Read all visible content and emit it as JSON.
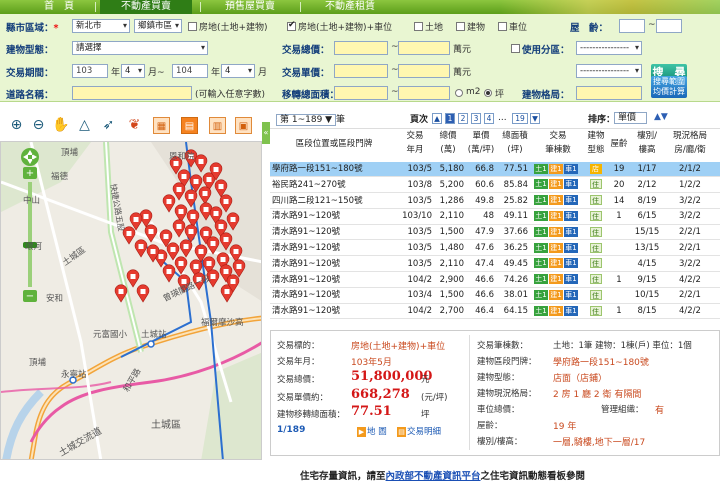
{
  "nav": {
    "tabs": [
      "首　頁",
      "不動產買賣",
      "預售屋買賣",
      "不動產租賃"
    ],
    "active": 1
  },
  "search": {
    "county_label": "縣市區域：",
    "county_value": "新北市",
    "district_value": "鄉鎮市區",
    "type_checks": [
      {
        "label": "房地(土地+建物)",
        "checked": false
      },
      {
        "label": "房地(土地+建物)+車位",
        "checked": true
      },
      {
        "label": "土地",
        "checked": false
      },
      {
        "label": "建物",
        "checked": false
      },
      {
        "label": "車位",
        "checked": false
      }
    ],
    "age_label": "屋　齡：",
    "age_sep": "~",
    "building_type_label": "建物型態：",
    "building_type_value": "請選擇",
    "total_price_label": "交易總價：",
    "unit_wan": "萬元",
    "range_sep": "~",
    "use_zone_label": "使用分區：",
    "use_zone_value1": "----------------",
    "use_zone_value2": "----------------",
    "search_button": "搜　尋",
    "period_label": "交易期間：",
    "year_from": "103",
    "month_from": "4",
    "year_to": "104",
    "month_to": "4",
    "year_word": "年",
    "month_word": "月~",
    "month_word_end": "月",
    "unit_price_label": "交易單價：",
    "road_label": "道路名稱：",
    "road_hint": "(可輸入任意字數)",
    "area_label": "移轉總面積：",
    "m2": "m2",
    "ping": "坪",
    "layout_label": "建物格局：",
    "calc_button": [
      "搜尋範圍",
      "均價計算"
    ]
  },
  "toolbar": {
    "icons": [
      "zoom-in-icon",
      "zoom-out-icon",
      "pan-icon",
      "measure-icon",
      "measure-area-icon",
      "marker-icon",
      "building-icon",
      "active-building-icon",
      "grid-icon",
      "layers-icon"
    ]
  },
  "map": {
    "labels": [
      "頂埔",
      "中山",
      "福德",
      "快捷公路五股",
      "土城區",
      "安和",
      "環河",
      "恩和院",
      "元富國小",
      "土城站",
      "永寧站",
      "和平路",
      "土城交流道",
      "土城區",
      "福爾摩沙高",
      "曾瑛閣路一段",
      "頂埔"
    ],
    "zoom_value": 0.55
  },
  "results": {
    "range_select": "第 1~189 ▼",
    "range_suffix": "筆",
    "page_label": "頁次",
    "pages": [
      "1",
      "2",
      "3",
      "4",
      "...",
      "19"
    ],
    "sort_label": "排序：",
    "sort_value": "單價",
    "sort_arrows": "▲▼",
    "headers": [
      "區段位置或區段門牌",
      "交易年月",
      "總價(萬)",
      "單價(萬/坪)",
      "總面積(坪)",
      "交易筆棟數",
      "建物型態",
      "屋齡",
      "樓別/樓高",
      "現況格局房廳衛"
    ],
    "rows": [
      {
        "addr": "學府路一段151~180號",
        "ym": "103/5",
        "total": "5,180",
        "unit": "66.8",
        "area": "77.51",
        "deal": [
          "土1",
          "建1",
          "車1"
        ],
        "type": "店",
        "age": "19",
        "floor": "1/17",
        "layout": "2/1/2",
        "selected": true
      },
      {
        "addr": "裕民路241~270號",
        "ym": "103/8",
        "total": "5,200",
        "unit": "60.6",
        "area": "85.84",
        "deal": [
          "土1",
          "建1",
          "車1"
        ],
        "type": "住",
        "age": "20",
        "floor": "2/12",
        "layout": "1/2/2",
        "selected": false
      },
      {
        "addr": "四川路二段121~150號",
        "ym": "103/5",
        "total": "1,286",
        "unit": "49.8",
        "area": "25.82",
        "deal": [
          "土1",
          "建1",
          "車1"
        ],
        "type": "住",
        "age": "14",
        "floor": "8/19",
        "layout": "3/2/2",
        "selected": false
      },
      {
        "addr": "清水路91~120號",
        "ym": "103/10",
        "total": "2,110",
        "unit": "48",
        "area": "49.11",
        "deal": [
          "土1",
          "建1",
          "車1"
        ],
        "type": "住",
        "age": "1",
        "floor": "6/15",
        "layout": "3/2/2",
        "selected": false
      },
      {
        "addr": "清水路91~120號",
        "ym": "103/5",
        "total": "1,500",
        "unit": "47.9",
        "area": "37.66",
        "deal": [
          "土1",
          "建1",
          "車1"
        ],
        "type": "住",
        "age": "",
        "floor": "15/15",
        "layout": "2/2/1",
        "selected": false
      },
      {
        "addr": "清水路91~120號",
        "ym": "103/5",
        "total": "1,480",
        "unit": "47.6",
        "area": "36.25",
        "deal": [
          "土1",
          "建1",
          "車1"
        ],
        "type": "住",
        "age": "",
        "floor": "13/15",
        "layout": "2/2/1",
        "selected": false
      },
      {
        "addr": "清水路91~120號",
        "ym": "103/5",
        "total": "2,110",
        "unit": "47.4",
        "area": "49.45",
        "deal": [
          "土1",
          "建1",
          "車1"
        ],
        "type": "住",
        "age": "",
        "floor": "4/15",
        "layout": "3/2/2",
        "selected": false
      },
      {
        "addr": "清水路91~120號",
        "ym": "104/2",
        "total": "2,900",
        "unit": "46.6",
        "area": "74.26",
        "deal": [
          "土1",
          "建1",
          "車1"
        ],
        "type": "住",
        "age": "1",
        "floor": "9/15",
        "layout": "4/2/2",
        "selected": false
      },
      {
        "addr": "清水路91~120號",
        "ym": "103/4",
        "total": "1,500",
        "unit": "46.6",
        "area": "38.01",
        "deal": [
          "土1",
          "建1",
          "車1"
        ],
        "type": "住",
        "age": "",
        "floor": "10/15",
        "layout": "2/2/1",
        "selected": false
      },
      {
        "addr": "清水路91~120號",
        "ym": "104/2",
        "total": "2,700",
        "unit": "46.4",
        "area": "64.15",
        "deal": [
          "土1",
          "建1",
          "車1"
        ],
        "type": "住",
        "age": "1",
        "floor": "8/15",
        "layout": "4/2/2",
        "selected": false
      }
    ]
  },
  "detail": {
    "category_label": "交易標的：",
    "category_value": "房地(土地+建物)+車位",
    "ym_label": "交易年月：",
    "ym_value": "103年5月",
    "total_label": "交易總價：",
    "total_value": "51,800,000",
    "total_unit": "元",
    "unit_label": "交易單價約：",
    "unit_value": "668,278",
    "unit_unit": "(元/坪)",
    "area_label": "建物移轉總面積：",
    "area_value": "77.51",
    "area_unit": "坪",
    "counter": "1/189",
    "map_link": "地 圖",
    "detail_link": "交易明細",
    "deal_count_label": "交易筆棟數：",
    "deal_count_value": "土地：1筆 建物：1棟(戶) 車位：1個",
    "addr_label": "建物區段門牌：",
    "addr_value": "學府路一段151~180號",
    "btype_label": "建物型態：",
    "btype_value": "店面（店鋪）",
    "layout_label": "建物現況格局：",
    "layout_value": "2 房 1 廳 2 衛 有隔間",
    "parking_label": "車位總價：",
    "mgmt_label": "管理組織：",
    "mgmt_value": "有",
    "age_label": "屋齡：",
    "age_value": "19 年",
    "floor_label": "樓別/樓高：",
    "floor_value": "一層,騎樓,地下一層/17"
  },
  "footer": {
    "prefix": "住宅存量資訊，請至",
    "link": "內政部不動產資訊平台",
    "suffix": "之住宅資訊動態看板參閱"
  },
  "colors": {
    "nav_green": "#5c9e1a",
    "panel_bg": "#e9f6d2",
    "marker_red": "#e53b2f",
    "selected_row": "#9fd0f5"
  }
}
